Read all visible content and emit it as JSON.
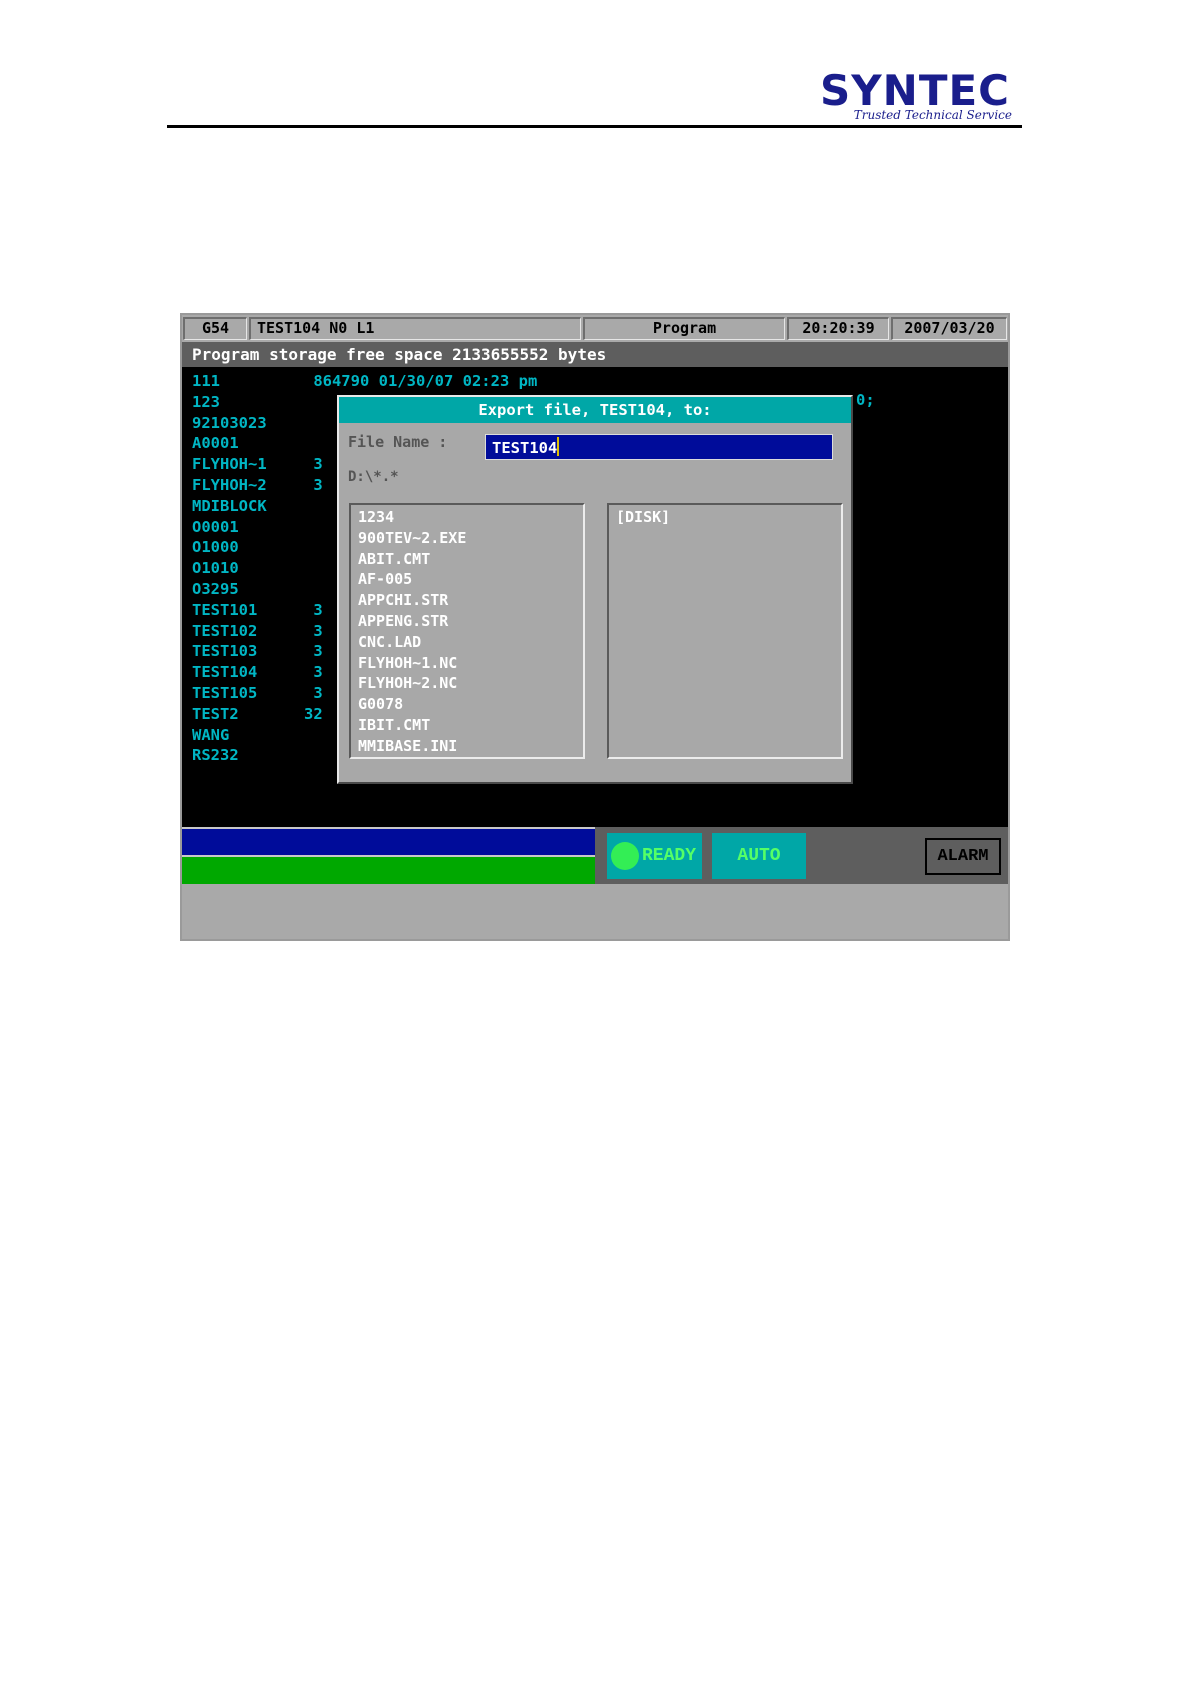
{
  "header": {
    "logo_text": "SYNTEC",
    "logo_tagline": "Trusted Technical Service"
  },
  "topbar": {
    "coord_system": "G54",
    "program_status": "TEST104 N0 L1",
    "mode_title": "Program",
    "time": "20:20:39",
    "date": "2007/03/20"
  },
  "info_bar": "Program storage free space 2133655552 bytes",
  "program_list": [
    "111          864790 01/30/07 02:23 pm",
    "123",
    "92103023",
    "A0001",
    "FLYHOH~1     3",
    "FLYHOH~2     3",
    "MDIBLOCK",
    "O0001",
    "O1000",
    "O1010",
    "O3295",
    "TEST101      3",
    "TEST102      3",
    "TEST103      3",
    "TEST104      3",
    "TEST105      3",
    "TEST2       32",
    "WANG",
    "RS232"
  ],
  "list_tail_fragment": "0;",
  "dialog": {
    "title": "Export file, TEST104, to:",
    "file_name_label": "File Name :",
    "file_name_value": "TEST104",
    "path": "D:\\*.*",
    "left_files": [
      "1234",
      "900TEV~2.EXE",
      "ABIT.CMT",
      "AF-005",
      "APPCHI.STR",
      "APPENG.STR",
      "CNC.LAD",
      "FLYHOH~1.NC",
      "FLYHOH~2.NC",
      "G0078",
      "IBIT.CMT",
      "MMIBASE.INI"
    ],
    "right_items": [
      "[DISK]"
    ]
  },
  "status": {
    "ready_label": "READY",
    "auto_label": "AUTO",
    "alarm_label": "ALARM"
  },
  "colors": {
    "list_text": "#00b6c4",
    "dialog_title_bg": "#00a7a7",
    "input_bg": "#000c9a",
    "status_green": "#00a800",
    "ready_indicator": "#33ee55"
  }
}
